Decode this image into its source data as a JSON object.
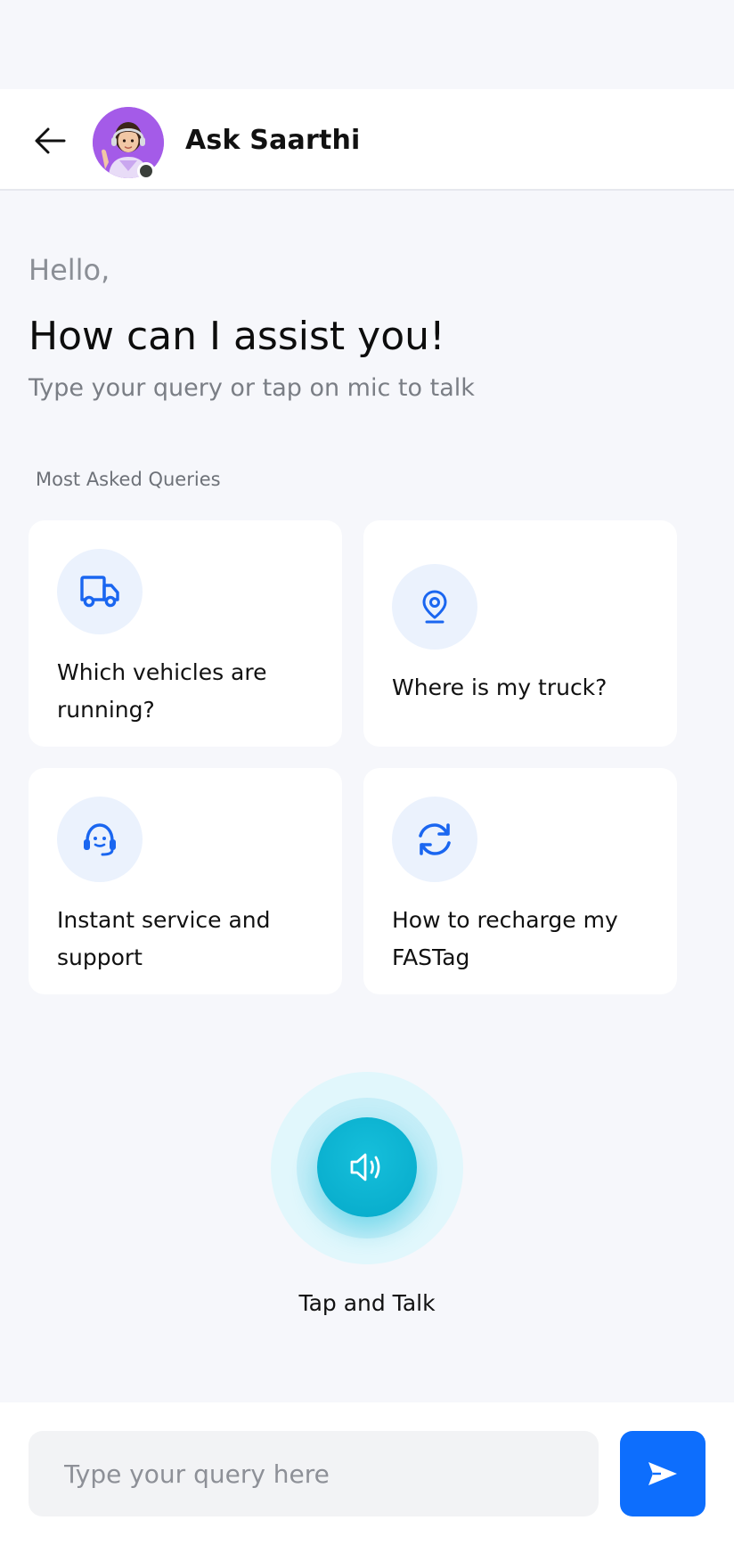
{
  "header": {
    "title": "Ask Saarthi",
    "avatar_status": "online"
  },
  "greeting": {
    "hello": "Hello,",
    "headline": "How can I assist you!",
    "subtitle": "Type your query or tap on mic to talk"
  },
  "queries": {
    "section_label": "Most Asked Queries",
    "items": [
      {
        "label": "Which vehicles are running?",
        "icon": "truck-icon"
      },
      {
        "label": "Where is my truck?",
        "icon": "location-pin-icon"
      },
      {
        "label": "Instant service and support",
        "icon": "headset-icon"
      },
      {
        "label": "How to recharge my FASTag",
        "icon": "refresh-icon"
      }
    ]
  },
  "voice": {
    "label": "Tap and Talk",
    "icon": "speaker-icon"
  },
  "composer": {
    "placeholder": "Type your query here",
    "send_icon": "send-icon"
  },
  "colors": {
    "accent_blue": "#0d6efd",
    "icon_blue": "#1a66f0",
    "mic_teal": "#08b1cf",
    "background": "#f6f7fb"
  }
}
